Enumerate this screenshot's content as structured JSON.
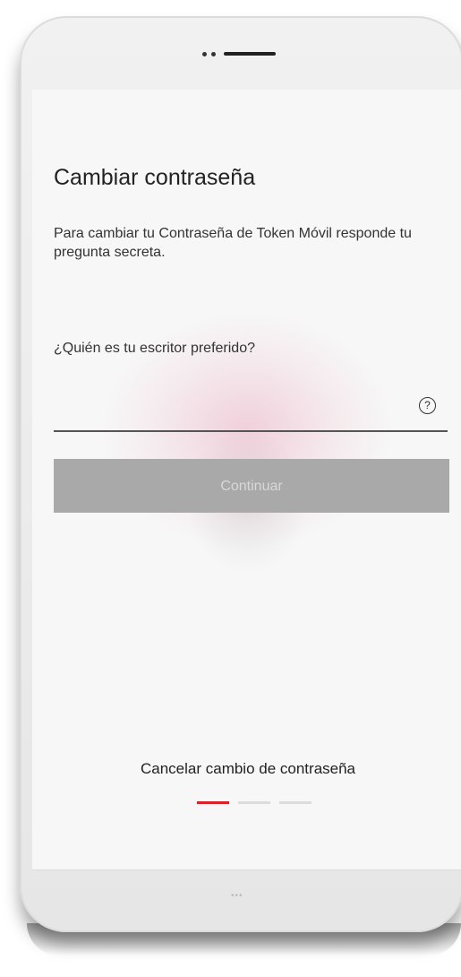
{
  "screen": {
    "title": "Cambiar contraseña",
    "description": "Para cambiar tu Contraseña de Token Móvil responde tu pregunta secreta.",
    "question_label": "¿Quién es tu escritor preferido?",
    "answer": {
      "value": "",
      "placeholder": ""
    },
    "help_icon": "question-circle-icon",
    "help_glyph": "?",
    "continue_label": "Continuar",
    "cancel_label": "Cancelar cambio de contraseña"
  },
  "progress": {
    "total_steps": 3,
    "current_step": 1
  },
  "colors": {
    "accent": "#d8232a",
    "button_disabled": "#a9a9a9",
    "button_text_disabled": "#d8d8d8"
  }
}
